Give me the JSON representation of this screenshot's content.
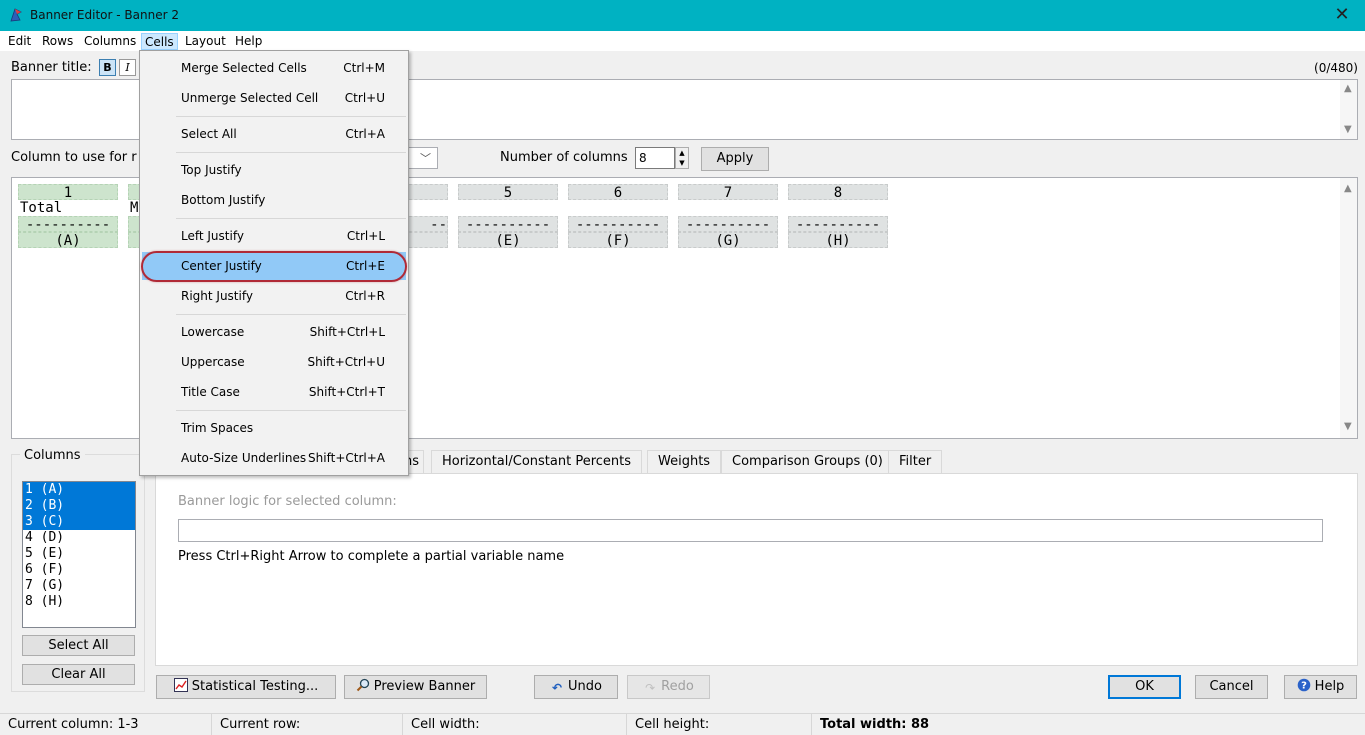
{
  "window": {
    "title": "Banner Editor - Banner 2",
    "close_glyph": "✕"
  },
  "menu": {
    "items": [
      "Edit",
      "Rows",
      "Columns",
      "Cells",
      "Layout",
      "Help"
    ]
  },
  "banner_title": {
    "label": "Banner title:",
    "bold_label": "B",
    "italic_label": "I",
    "char_count": "(0/480)"
  },
  "controls": {
    "column_label": "Column to use for r",
    "num_columns_label": "Number of columns",
    "num_columns_value": "8",
    "apply_label": "Apply"
  },
  "grid": {
    "columns": [
      {
        "number": "1",
        "header": "Total",
        "underline": "----------",
        "letter": "(A)",
        "selected": true
      },
      {
        "number": "",
        "header": "M",
        "underline": "",
        "letter": "",
        "selected": true
      },
      {
        "number": "",
        "header": "",
        "underline": "",
        "letter": "",
        "selected": true
      },
      {
        "number": "",
        "header": "",
        "underline": "--",
        "letter": "",
        "selected": false
      },
      {
        "number": "5",
        "header": "",
        "underline": "----------",
        "letter": "(E)",
        "selected": false
      },
      {
        "number": "6",
        "header": "",
        "underline": "----------",
        "letter": "(F)",
        "selected": false
      },
      {
        "number": "7",
        "header": "",
        "underline": "----------",
        "letter": "(G)",
        "selected": false
      },
      {
        "number": "8",
        "header": "",
        "underline": "----------",
        "letter": "(H)",
        "selected": false
      }
    ]
  },
  "columns_panel": {
    "label": "Columns",
    "items": [
      {
        "label": "1 (A)",
        "selected": true
      },
      {
        "label": "2 (B)",
        "selected": true
      },
      {
        "label": "3 (C)",
        "selected": true
      },
      {
        "label": "4 (D)",
        "selected": false
      },
      {
        "label": "5 (E)",
        "selected": false
      },
      {
        "label": "6 (F)",
        "selected": false
      },
      {
        "label": "7 (G)",
        "selected": false
      },
      {
        "label": "8 (H)",
        "selected": false
      }
    ],
    "select_all_label": "Select All",
    "clear_all_label": "Clear All"
  },
  "tabs": {
    "partial_label": "ns",
    "horizontal_label": "Horizontal/Constant Percents",
    "weights_label": "Weights",
    "comparison_label": "Comparison Groups (0)",
    "filter_label": "Filter"
  },
  "logic": {
    "label": "Banner logic for selected column:",
    "value": "",
    "hint": "Press Ctrl+Right Arrow to complete a partial variable name"
  },
  "buttons": {
    "statistical": "Statistical Testing...",
    "preview": "Preview Banner",
    "undo": "Undo",
    "redo": "Redo",
    "ok": "OK",
    "cancel": "Cancel",
    "help": "Help"
  },
  "status": {
    "current_column": "Current column: 1-3",
    "current_row": "Current row:",
    "cell_width": "Cell width:",
    "cell_height": "Cell height:",
    "total_width": "Total width: 88"
  },
  "cells_menu": {
    "merge": {
      "label": "Merge Selected Cells",
      "shortcut": "Ctrl+M"
    },
    "unmerge": {
      "label": "Unmerge Selected Cell",
      "shortcut": "Ctrl+U"
    },
    "select_all": {
      "label": "Select All",
      "shortcut": "Ctrl+A"
    },
    "top": {
      "label": "Top Justify",
      "shortcut": ""
    },
    "bottom": {
      "label": "Bottom Justify",
      "shortcut": ""
    },
    "left": {
      "label": "Left Justify",
      "shortcut": "Ctrl+L"
    },
    "center": {
      "label": "Center Justify",
      "shortcut": "Ctrl+E"
    },
    "right": {
      "label": "Right Justify",
      "shortcut": "Ctrl+R"
    },
    "lower": {
      "label": "Lowercase",
      "shortcut": "Shift+Ctrl+L"
    },
    "upper": {
      "label": "Uppercase",
      "shortcut": "Shift+Ctrl+U"
    },
    "title": {
      "label": "Title Case",
      "shortcut": "Shift+Ctrl+T"
    },
    "trim": {
      "label": "Trim Spaces",
      "shortcut": ""
    },
    "autosize": {
      "label": "Auto-Size Underlines",
      "shortcut": "Shift+Ctrl+A"
    }
  },
  "colors": {
    "titlebar": "#00b2c2",
    "selection": "#0078d7",
    "menu_highlight": "#91c9f7",
    "annotation_ring": "#b02a37"
  }
}
